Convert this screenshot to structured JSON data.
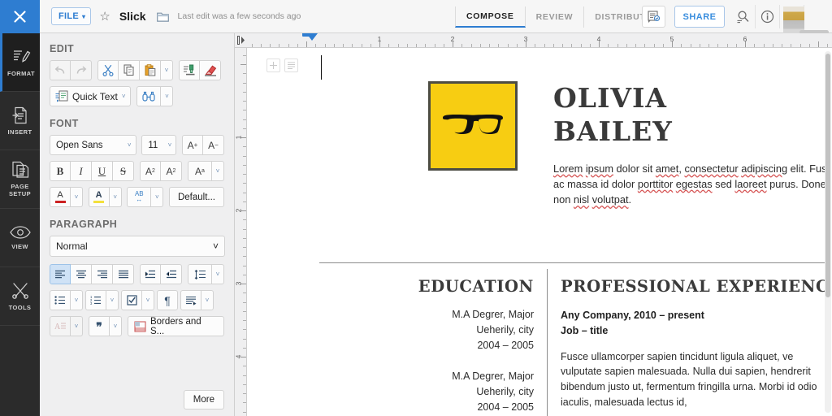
{
  "topbar": {
    "close_label": "close-window",
    "file_button": "FILE",
    "file_caret": "▾",
    "star_icon": "☆",
    "doc_title": "Slick",
    "last_edit": "Last edit was a few seconds ago",
    "tabs": [
      {
        "label": "COMPOSE",
        "active": true
      },
      {
        "label": "REVIEW",
        "active": false
      },
      {
        "label": "DISTRIBUTE",
        "active": false
      }
    ],
    "share_label": "SHARE"
  },
  "rail": {
    "items": [
      {
        "label": "FORMAT",
        "active": true
      },
      {
        "label": "INSERT",
        "active": false
      },
      {
        "label": "PAGE\nSETUP",
        "line1": "PAGE",
        "line2": "SETUP",
        "active": false
      },
      {
        "label": "VIEW",
        "active": false
      },
      {
        "label": "TOOLS",
        "active": false
      }
    ]
  },
  "panel": {
    "edit_title": "EDIT",
    "font_title": "FONT",
    "paragraph_title": "PARAGRAPH",
    "quick_text": "Quick Text",
    "caret": "˅",
    "font_name": "Open Sans",
    "font_size": "11",
    "grow_font": "A",
    "shrink_font": "A",
    "bold": "B",
    "italic": "I",
    "underline": "U",
    "strike": "S",
    "superscript": "A",
    "subscript": "A",
    "change_case": "A",
    "superscript_sup": "2",
    "subscript_sub": "2",
    "case_sub": "a",
    "font_color": "A",
    "highlight": "A",
    "char_spacing": "AB",
    "default_btn": "Default...",
    "paragraph_style": "Normal",
    "borders_btn": "Borders and S...",
    "more_btn": "More"
  },
  "ruler": {
    "h_numbers": [
      "1",
      "2",
      "3",
      "4",
      "5",
      "6"
    ],
    "v_numbers": [
      "1",
      "2",
      "3",
      "4"
    ]
  },
  "document": {
    "first_name": "OLIVIA",
    "last_name": "BAILEY",
    "bio_parts": [
      {
        "t": "Lorem",
        "sq": true
      },
      {
        "t": " ",
        "sq": false
      },
      {
        "t": "ipsum",
        "sq": true
      },
      {
        "t": " dolor sit ",
        "sq": false
      },
      {
        "t": "amet",
        "sq": true
      },
      {
        "t": ", ",
        "sq": false
      },
      {
        "t": "consectetur",
        "sq": true
      },
      {
        "t": " ",
        "sq": false
      },
      {
        "t": "adipiscing",
        "sq": true
      },
      {
        "t": " elit. Fusce ac massa id dolor ",
        "sq": false
      },
      {
        "t": "porttitor",
        "sq": true
      },
      {
        "t": " ",
        "sq": false
      },
      {
        "t": "egestas",
        "sq": true
      },
      {
        "t": " sed ",
        "sq": false
      },
      {
        "t": "laoreet",
        "sq": true
      },
      {
        "t": " purus. Donec non ",
        "sq": false
      },
      {
        "t": "nisl",
        "sq": true
      },
      {
        "t": " ",
        "sq": false
      },
      {
        "t": "volutpat",
        "sq": true
      },
      {
        "t": ".",
        "sq": false
      }
    ],
    "bio_plain": "Lorem ipsum dolor sit amet, consectetur adipiscing elit. Fusce ac massa id dolor porttitor egestas sed laoreet purus. Donec non nisl volutpat.",
    "education_heading": "EDUCATION",
    "education_entries": [
      {
        "degree": "M.A Degrer, Major",
        "place": "Ueherily, city",
        "years": "2004 – 2005"
      },
      {
        "degree": "M.A Degrer, Major",
        "place": "Ueherily, city",
        "years": "2004 – 2005"
      }
    ],
    "experience_heading": "PROFESSIONAL EXPERIENC",
    "experience_company": "Any Company, 2010 – present",
    "experience_job": "Job – title",
    "experience_body": "Fusce ullamcorper sapien tincidunt ligula aliquet, ve vulputate sapien malesuada. Nulla dui sapien, hendrerit bibendum justo ut, fermentum fringilla urna. Morbi id odio iaculis, malesuada lectus id,"
  },
  "colors": {
    "accent_blue": "#2e7dd1",
    "rail_dark": "#2b2b2b",
    "panel_grey": "#efeff0",
    "logo_yellow": "#f7cd12",
    "doc_heading": "#3a3a3a",
    "spellcheck_red": "#d75858"
  }
}
